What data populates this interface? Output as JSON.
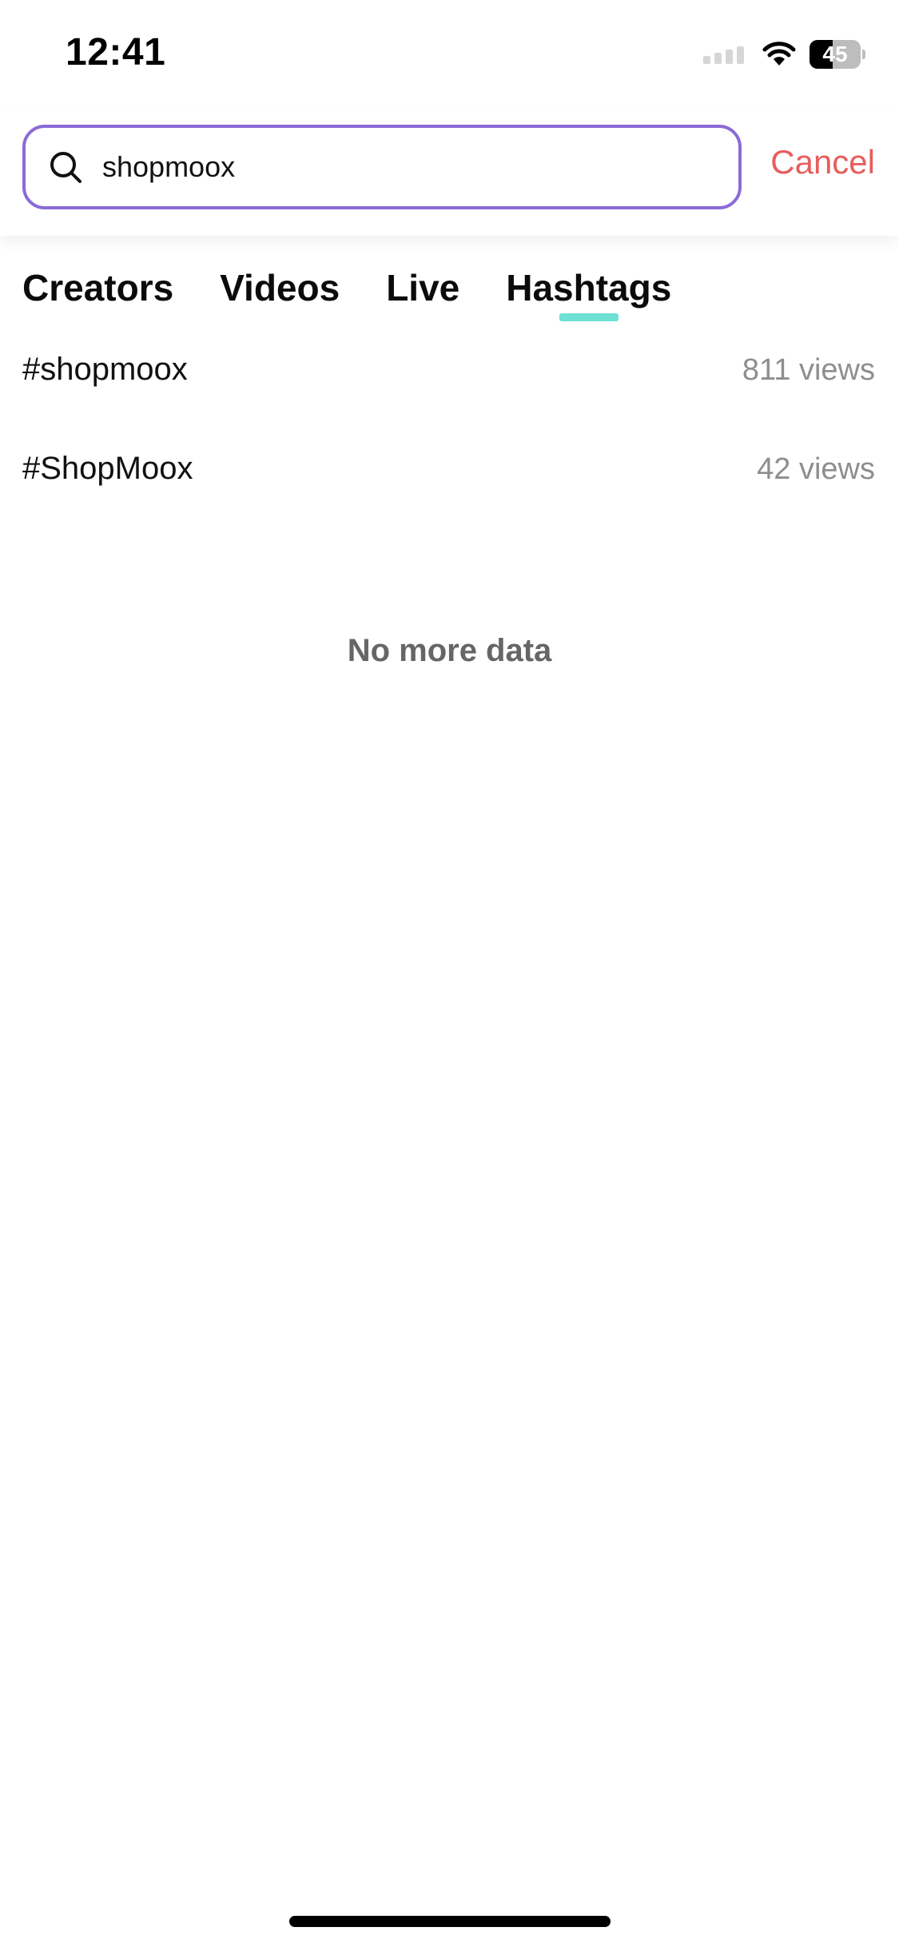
{
  "status_bar": {
    "time": "12:41",
    "battery": "45",
    "battery_level": 0.45
  },
  "search": {
    "value": "shopmoox",
    "cancel_label": "Cancel",
    "border_color": "#8a6bd6",
    "cancel_color": "#e85d5d"
  },
  "tabs": [
    {
      "label": "Creators",
      "active": false
    },
    {
      "label": "Videos",
      "active": false
    },
    {
      "label": "Live",
      "active": false
    },
    {
      "label": "Hashtags",
      "active": true
    }
  ],
  "tab_indicator_color": "#6ee0d4",
  "hashtags": [
    {
      "name": "#shopmoox",
      "views": "811 views"
    },
    {
      "name": "#ShopMoox",
      "views": "42 views"
    }
  ],
  "footer_message": "No more data"
}
